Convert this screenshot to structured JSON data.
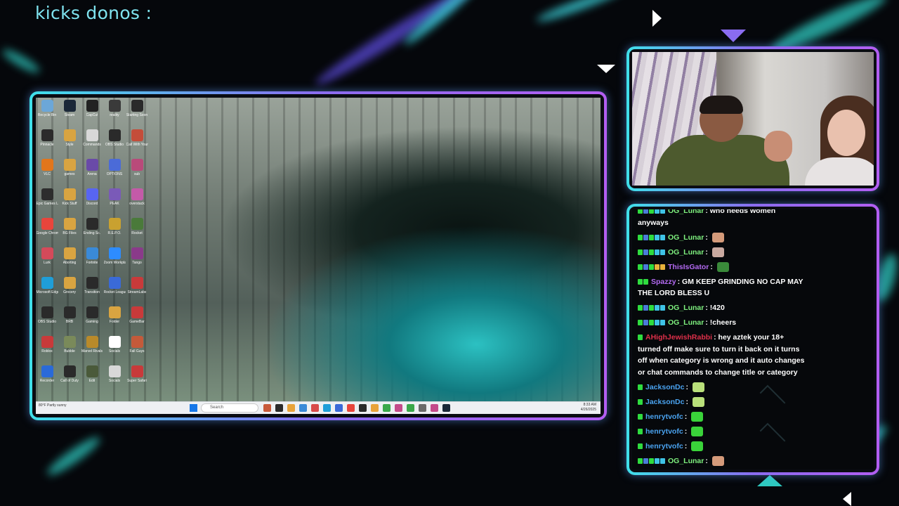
{
  "overlay": {
    "title": "kicks donos :",
    "accent_teal": "#3fe0ea",
    "accent_purple": "#8a6cf0"
  },
  "screen_share": {
    "desktop_icons": [
      {
        "label": "Recycle Bin",
        "color": "#6ca7d8"
      },
      {
        "label": "Steam",
        "color": "#1b2838"
      },
      {
        "label": "CapCut",
        "color": "#222222"
      },
      {
        "label": "reality",
        "color": "#3a3a3a"
      },
      {
        "label": "Starting Soon",
        "color": "#2a2a2a"
      },
      {
        "label": "Pinnacle",
        "color": "#2b2b2b"
      },
      {
        "label": "Style",
        "color": "#d9a441"
      },
      {
        "label": "Commands",
        "color": "#d8d8d8"
      },
      {
        "label": "OBS Studio",
        "color": "#2a2a2a"
      },
      {
        "label": "Call With Your Friends",
        "color": "#c44d3a"
      },
      {
        "label": "VLC",
        "color": "#e2761b"
      },
      {
        "label": "games",
        "color": "#d9a441"
      },
      {
        "label": "Arena",
        "color": "#6a4aa8"
      },
      {
        "label": "OPTIONS",
        "color": "#4b6bd8"
      },
      {
        "label": "sub",
        "color": "#b94a7a"
      },
      {
        "label": "Epic Games Launcher",
        "color": "#2d2d2d"
      },
      {
        "label": "Kick Stuff",
        "color": "#d9a441"
      },
      {
        "label": "Discord",
        "color": "#5865f2"
      },
      {
        "label": "PEAK",
        "color": "#7a5ab8"
      },
      {
        "label": "overstack",
        "color": "#c45aa8"
      },
      {
        "label": "Google Chrome",
        "color": "#e8453c"
      },
      {
        "label": "BG Files",
        "color": "#d9a441"
      },
      {
        "label": "Ending Sc.",
        "color": "#2a2a2a"
      },
      {
        "label": "R.E.P.O.",
        "color": "#c9a130"
      },
      {
        "label": "Rocket",
        "color": "#4a7a3a"
      },
      {
        "label": "Lurk",
        "color": "#d44a5a"
      },
      {
        "label": "Aborting",
        "color": "#d9a441"
      },
      {
        "label": "Fortnite",
        "color": "#3a8ad8"
      },
      {
        "label": "Zoom Workplace",
        "color": "#2d8cff"
      },
      {
        "label": "Tango",
        "color": "#8a3a8a"
      },
      {
        "label": "Microsoft Edge",
        "color": "#1f9ed8"
      },
      {
        "label": "Grocery",
        "color": "#d9a441"
      },
      {
        "label": "Transition",
        "color": "#2a2a2a"
      },
      {
        "label": "Rocket League",
        "color": "#3a6ad8"
      },
      {
        "label": "StreamLabs",
        "color": "#c83a3a"
      },
      {
        "label": "OBS Studio",
        "color": "#2a2a2a"
      },
      {
        "label": "BRB",
        "color": "#2a2a2a"
      },
      {
        "label": "Gaming",
        "color": "#2a2a2a"
      },
      {
        "label": "Folder",
        "color": "#d9a441"
      },
      {
        "label": "GameBar",
        "color": "#c83a3a"
      },
      {
        "label": "Roblox",
        "color": "#c83a3a"
      },
      {
        "label": "Bubble",
        "color": "#7a8a5a"
      },
      {
        "label": "Marvel Rivals",
        "color": "#b98a2a"
      },
      {
        "label": "Socials",
        "color": "#ffffff"
      },
      {
        "label": "Fall Guys",
        "color": "#c45a3a"
      },
      {
        "label": "Recorder",
        "color": "#2a6ad8"
      },
      {
        "label": "Call of Duty",
        "color": "#2a2a2a"
      },
      {
        "label": "Edit",
        "color": "#4a5a3a"
      },
      {
        "label": "Socials",
        "color": "#d8d8d8"
      },
      {
        "label": "Super Safari",
        "color": "#c83a3a"
      }
    ],
    "taskbar": {
      "weather": "80°F Partly sunny",
      "search_placeholder": "Search",
      "apps": [
        "#c85a3a",
        "#2a2a2a",
        "#e8a33a",
        "#3a8ad8",
        "#d84a4a",
        "#1f9ed8",
        "#3a6ad8",
        "#e8453c",
        "#2a2a2a",
        "#e8a33a",
        "#3aa84a",
        "#c44a8a",
        "#3aa84a",
        "#6a6a6a",
        "#c44a8a",
        "#1b2838"
      ],
      "time": "8:33 AM",
      "date": "4/26/2025"
    }
  },
  "chat": {
    "messages": [
      {
        "user": "OG_Lunar",
        "user_color": "#7ef07e",
        "text": "who needs women anyways",
        "badges": [
          "#2fdc3f",
          "#4a7bd8",
          "#2fdc3f",
          "#3ec3e6",
          "#3ec3e6"
        ],
        "emote": ""
      },
      {
        "user": "OG_Lunar",
        "user_color": "#7ef07e",
        "text": "",
        "badges": [
          "#2fdc3f",
          "#4a7bd8",
          "#2fdc3f",
          "#3ec3e6",
          "#3ec3e6"
        ],
        "emote": "#d49a7a"
      },
      {
        "user": "OG_Lunar",
        "user_color": "#7ef07e",
        "text": "",
        "badges": [
          "#2fdc3f",
          "#4a7bd8",
          "#2fdc3f",
          "#3ec3e6",
          "#3ec3e6"
        ],
        "emote": "#c9a9a0"
      },
      {
        "user": "ThisIsGator",
        "user_color": "#b36af2",
        "text": "",
        "badges": [
          "#2fdc3f",
          "#4a7bd8",
          "#2fdc3f",
          "#e8b23a",
          "#e8b23a"
        ],
        "emote": "#3a8a3a"
      },
      {
        "user": "Spazzy",
        "user_color": "#b36af2",
        "text": "GM KEEP GRINDING NO CAP MAY THE LORD BLESS U",
        "badges": [
          "#2fdc3f",
          "#2fdc3f"
        ],
        "emote": ""
      },
      {
        "user": "OG_Lunar",
        "user_color": "#7ef07e",
        "text": "!420",
        "badges": [
          "#2fdc3f",
          "#4a7bd8",
          "#2fdc3f",
          "#3ec3e6",
          "#3ec3e6"
        ],
        "emote": ""
      },
      {
        "user": "OG_Lunar",
        "user_color": "#7ef07e",
        "text": "!cheers",
        "badges": [
          "#2fdc3f",
          "#4a7bd8",
          "#2fdc3f",
          "#3ec3e6",
          "#3ec3e6"
        ],
        "emote": ""
      },
      {
        "user": "AHighJewishRabbi",
        "user_color": "#e0304a",
        "text": "hey aztek your 18+ turned off make sure to turn it back on it turns off when category is wrong and it auto changes or chat commands to change title or category",
        "badges": [
          "#2fdc3f"
        ],
        "emote": ""
      },
      {
        "user": "JacksonDc",
        "user_color": "#4aa3f0",
        "text": "",
        "badges": [
          "#2fdc3f"
        ],
        "emote": "#b9e07a"
      },
      {
        "user": "JacksonDc",
        "user_color": "#4aa3f0",
        "text": "",
        "badges": [
          "#2fdc3f"
        ],
        "emote": "#b9e07a"
      },
      {
        "user": "henrytvofc",
        "user_color": "#4aa3f0",
        "text": "",
        "badges": [
          "#2fdc3f"
        ],
        "emote": "#3ad33a"
      },
      {
        "user": "henrytvofc",
        "user_color": "#4aa3f0",
        "text": "",
        "badges": [
          "#2fdc3f"
        ],
        "emote": "#3ad33a"
      },
      {
        "user": "henrytvofc",
        "user_color": "#4aa3f0",
        "text": "",
        "badges": [
          "#2fdc3f"
        ],
        "emote": "#3ad33a"
      },
      {
        "user": "OG_Lunar",
        "user_color": "#7ef07e",
        "text": "",
        "badges": [
          "#2fdc3f",
          "#4a7bd8",
          "#2fdc3f",
          "#3ec3e6",
          "#3ec3e6"
        ],
        "emote": "#d49a7a"
      }
    ]
  }
}
